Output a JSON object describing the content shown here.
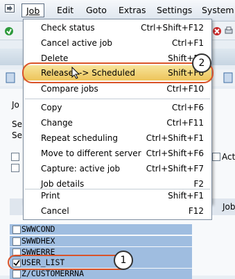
{
  "menubar": {
    "items": [
      {
        "label": "Job"
      },
      {
        "label": "Edit"
      },
      {
        "label": "Goto"
      },
      {
        "label": "Extras"
      },
      {
        "label": "Settings"
      },
      {
        "label": "System"
      }
    ]
  },
  "menu": {
    "items": [
      {
        "label": "Check status",
        "shortcut": "Ctrl+Shift+F12"
      },
      {
        "label": "Cancel active job",
        "shortcut": "Ctrl+F1"
      },
      {
        "label": "Delete",
        "shortcut": "Shift+F2"
      },
      {
        "label": "Release --> Scheduled",
        "shortcut": "Shift+F6"
      },
      {
        "label": "Compare jobs",
        "shortcut": "Ctrl+F10"
      },
      {
        "label": "Copy",
        "shortcut": "Ctrl+F6"
      },
      {
        "label": "Change",
        "shortcut": "Ctrl+F11"
      },
      {
        "label": "Repeat scheduling",
        "shortcut": "Ctrl+Shift+F1"
      },
      {
        "label": "Move to different server",
        "shortcut": "Ctrl+Shift+F6"
      },
      {
        "label": "Capture: active job",
        "shortcut": "Ctrl+Shift+F7"
      },
      {
        "label": "Job details",
        "shortcut": "F2"
      },
      {
        "label": "Print",
        "shortcut": "Shift+F1"
      },
      {
        "label": "Cancel",
        "shortcut": "F12"
      }
    ]
  },
  "background": {
    "left_labels": [
      "Jo",
      "Se",
      "Se"
    ],
    "right_label": "Act",
    "column_header": "Job"
  },
  "list": {
    "rows": [
      "SWWCOND",
      "SWWDHEX",
      "SWWERRE",
      "USER_LIST",
      "Z/CUSTOMERRNA"
    ],
    "checked_row": "USER_LIST"
  },
  "callouts": {
    "one": "1",
    "two": "2"
  },
  "colors": {
    "highlight": "#edc45a",
    "selection": "#9fbde0",
    "callout_ring": "#d9532a"
  }
}
